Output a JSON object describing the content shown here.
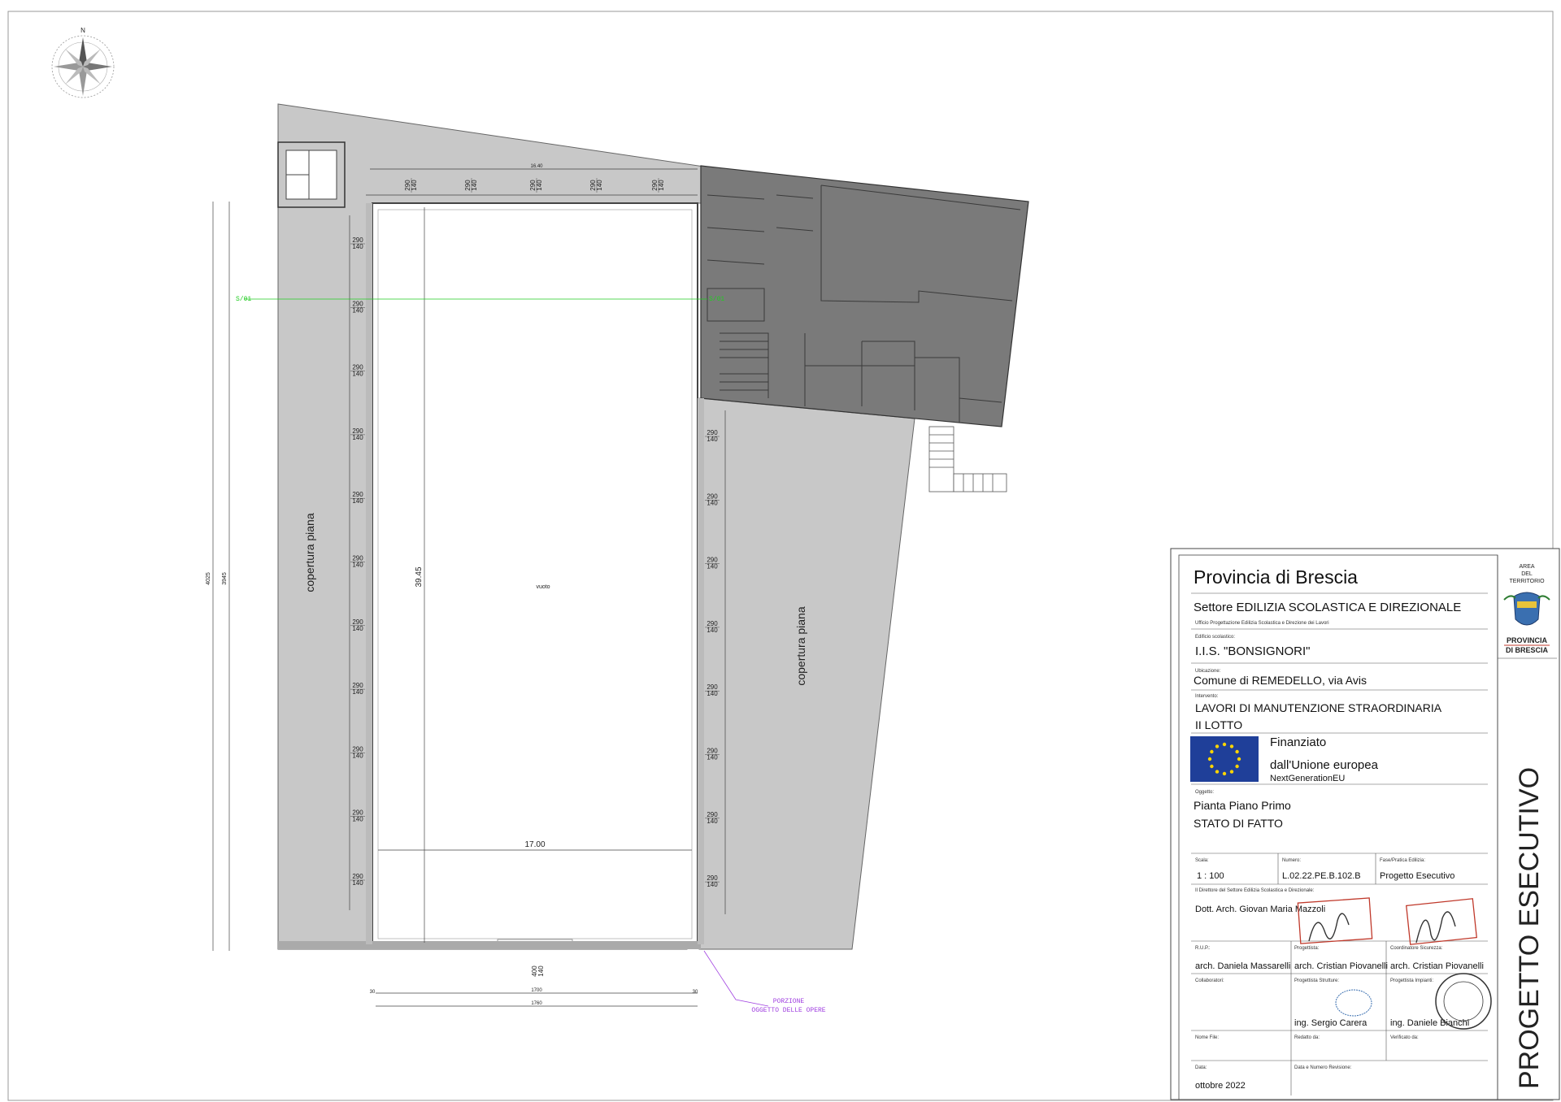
{
  "plan": {
    "compass_label": "N",
    "roof_left": "copertura piana",
    "roof_right": "copertura piana",
    "void_label": "vuoto",
    "dim_height": "39.45",
    "dim_width": "17.00",
    "dim_total_left": "4025",
    "dim_inner_left": "3945",
    "dim_top": "16.40",
    "dim_bottom_1": "1700",
    "dim_bottom_2": "1760",
    "dim_bottom_left": "30",
    "dim_bottom_right": "30",
    "dim_door": "400",
    "dim_door_sub": "140",
    "window_top": "290",
    "window_bottom": "140",
    "section_mark_left": "S/01",
    "section_mark_right": "S/01",
    "portion_line1": "PORZIONE",
    "portion_line2": "OGGETTO DELLE OPERE"
  },
  "title_block": {
    "province": "Provincia di Brescia",
    "sector": "Settore EDILIZIA SCOLASTICA E DIREZIONALE",
    "office": "Ufficio Progettazione Edilizia Scolastica e Direzione dei Lavori",
    "building_label": "Edificio scolastico:",
    "building": "I.I.S. \"BONSIGNORI\"",
    "location_label": "Ubicazione:",
    "location": "Comune di REMEDELLO, via Avis",
    "intervention_label": "Intervento:",
    "intervention_1": "LAVORI DI MANUTENZIONE STRAORDINARIA",
    "intervention_2": "II  LOTTO",
    "eu_1": "Finanziato",
    "eu_2": "dall'Unione europea",
    "eu_3": "NextGenerationEU",
    "object_label": "Oggetto:",
    "object_1": "Pianta Piano Primo",
    "object_2": "STATO DI FATTO",
    "scale_label": "Scala:",
    "scale": "1 : 100",
    "number_label": "Numero:",
    "number": "L.02.22.PE.B.102.B",
    "phase_label": "Fase/Pratica Edilizia:",
    "phase": "Progetto  Esecutivo",
    "director_label": "Il Direttore del Settore Edilizia Scolastica e Direzionale:",
    "director": "Dott. Arch. Giovan Maria Mazzoli",
    "rup_label": "R.U.P.:",
    "rup": "arch. Daniela Massarelli",
    "designer_label": "Progettista:",
    "designer": "arch. Cristian Piovanelli",
    "coordinator_label": "Coordinatore Sicurezza:",
    "coordinator": "arch. Cristian Piovanelli",
    "collab_label": "Collaboratori:",
    "structural_label": "Progettista Strutture:",
    "structural": "ing. Sergio Carera",
    "plant_label": "Progettista Impianti:",
    "plant": "ing. Daniele Bianchi",
    "file_label": "Nome File:",
    "drafted_label": "Redatto da:",
    "verified_label": "Verificato da:",
    "date_label": "Data:",
    "date": "ottobre 2022",
    "revision_label": "Data e Numero Revisione:",
    "vertical": "PROGETTO ESECUTIVO",
    "logo_area_1": "AREA",
    "logo_area_2": "DEL",
    "logo_area_3": "TERRITORIO",
    "logo_prov_1": "PROVINCIA",
    "logo_prov_2": "DI BRESCIA"
  },
  "colors": {
    "roof_fill": "#c8c8c8",
    "building_fill": "#7a7a7a",
    "section_green": "#22cc22",
    "portion_purple": "#a040e0",
    "eu_blue": "#1f3f99",
    "eu_star": "#ffd500",
    "stamp_red": "#c0392b"
  }
}
